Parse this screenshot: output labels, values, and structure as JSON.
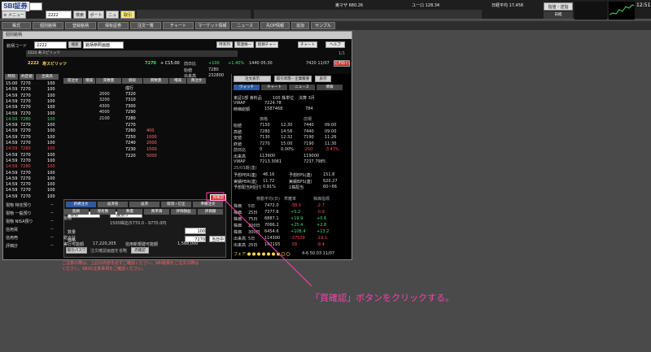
{
  "header": {
    "logo": "SBI証券",
    "code": "2222",
    "search_btn": "検索",
    "menu1": "ポートフォ",
    "menu2": "ニュース",
    "sell_btn": "取引",
    "clock": "12:51",
    "user_btn": "指値・逆指",
    "corner": "1%",
    "mini_labels": [
      "日経",
      "JASDAQ平",
      "NYダウ"
    ]
  },
  "indices": [
    "東マザ 680.26",
    "ユーロ 128.34",
    "日経平均 17,458"
  ],
  "menubar": {
    "items": [
      "株式",
      "個別銘柄",
      "登録銘柄",
      "保有証券",
      "注文一覧",
      "チャート",
      "マーケット情報",
      "ニュース",
      "先OP情報",
      "追加",
      "サンプル"
    ]
  },
  "window": {
    "title": "個別銘柄",
    "code_label": "銘柄コード",
    "code": "2222",
    "search_btn": "検索",
    "combo": "銘柄参照画面",
    "tag_buttons": [
      "時系列",
      "関連株一覧",
      "銘柄チャート",
      "チャート",
      "ヘルプ"
    ],
    "subcode": "2222 寿スピリッツ",
    "page": "1/1"
  },
  "stock": {
    "code": "2222",
    "name": "寿スピリッツ",
    "price": "7270",
    "change": "+ C15:00",
    "prev": "前日比",
    "diff": "+100",
    "pct": "+1.40%",
    "high": "1440 05:30",
    "time": "7420 11/07",
    "open_label": "始値",
    "open": "7280",
    "volume": "出来高",
    "vol_val": "232800",
    "buy_limit": "信用取引"
  },
  "ticks": {
    "headers": [
      "時刻",
      "約定値",
      "出来高"
    ],
    "rows": [
      [
        "15:00",
        "7270",
        "100"
      ],
      [
        "14:59",
        "7270",
        "100"
      ],
      [
        "14:59",
        "7270",
        "100"
      ],
      [
        "14:59",
        "7270",
        "100"
      ],
      [
        "14:59",
        "7270",
        "100"
      ],
      [
        "14:59",
        "7270",
        "100"
      ],
      [
        "14:59",
        "7280",
        "100"
      ],
      [
        "14:59",
        "7270",
        "100"
      ],
      [
        "14:59",
        "7270",
        "100"
      ],
      [
        "14:59",
        "7270",
        "100"
      ],
      [
        "14:59",
        "7270",
        "100"
      ],
      [
        "14:59",
        "7280",
        "100"
      ],
      [
        "14:59",
        "7270",
        "100"
      ],
      [
        "14:59",
        "7270",
        "100"
      ],
      [
        "14:59",
        "7280",
        "100"
      ],
      [
        "14:59",
        "7270",
        "100"
      ],
      [
        "14:59",
        "7270",
        "100"
      ],
      [
        "14:59",
        "7270",
        "100"
      ],
      [
        "14:59",
        "7270",
        "100"
      ],
      [
        "14:59",
        "7270",
        "100"
      ]
    ],
    "red_rows": [
      11,
      14
    ],
    "grn_rows": [
      6
    ]
  },
  "board": {
    "headers": [
      "売注文",
      "増減",
      "売数量",
      "値段",
      "買数量",
      "増減",
      "買注文"
    ],
    "rows": [
      [
        "",
        "",
        "",
        "成行",
        "",
        "",
        ""
      ],
      [
        "",
        "",
        "2000",
        "7320",
        "",
        "",
        ""
      ],
      [
        "",
        "",
        "3200",
        "7310",
        "",
        "",
        ""
      ],
      [
        "",
        "",
        "4300",
        "7300",
        "",
        "",
        ""
      ],
      [
        "",
        "",
        "4000",
        "7290",
        "",
        "",
        ""
      ],
      [
        "",
        "",
        "2100",
        "7280",
        "",
        "",
        ""
      ],
      [
        "",
        "",
        "",
        "7270",
        "",
        "",
        ""
      ],
      [
        "",
        "",
        "",
        "7260",
        "400",
        "",
        ""
      ],
      [
        "",
        "",
        "",
        "7250",
        "1000",
        "",
        ""
      ],
      [
        "",
        "",
        "",
        "7240",
        "2000",
        "",
        ""
      ],
      [
        "",
        "",
        "",
        "7230",
        "1500",
        "",
        ""
      ],
      [
        "",
        "",
        "",
        "7220",
        "5000",
        "",
        ""
      ]
    ]
  },
  "order": {
    "tabs": [
      "新規注文",
      "返済売",
      "返済",
      "取消・訂正",
      "準備注文"
    ],
    "kind": "現物",
    "sel": "一般預り",
    "price_limit": "1500株迄/5770.0 - 9770.0円",
    "qty_label": "数量",
    "qty": "100",
    "price_label": "価格",
    "price": "7270",
    "cond": "当日中",
    "pw": "取引パスワード",
    "preview_btn": "買確認",
    "confirm_btn": "注文確認画面を省略",
    "sell_btn": "売確認"
  },
  "holdings": {
    "rows": [
      [
        "現物 特定預り",
        "--"
      ],
      [
        "現物 一般預り",
        "--"
      ],
      [
        "現物 NISA預り",
        "--"
      ],
      [
        "信用買",
        "--"
      ],
      [
        "信用売",
        "--"
      ],
      [
        "評価計",
        "--"
      ]
    ]
  },
  "positions": {
    "headers": [
      "銘柄",
      "保有数",
      "数量",
      "買単価",
      "評価損益",
      "評価額"
    ],
    "total": "総合計",
    "row": "現物",
    "cash": "実行可能額",
    "cash_val": "17,220,205",
    "margin": "信用新規建可能額",
    "margin_val": "1,568,000"
  },
  "right": {
    "tabs": [
      "注文表示",
      "取引状態・企業概要",
      "表示"
    ],
    "subtabs": [
      "ウォッチ",
      "チャート",
      "ニュース",
      "情報"
    ],
    "company": "東証1部 食料品",
    "rate": "100 株単位",
    "trade": "50 月",
    "settle": "決算 3月",
    "vwap_label": "VWAP",
    "vwap": "7224.78",
    "market_cap": "時価総額",
    "mc": "1587468",
    "turnover": "売買代金",
    "tv": "784"
  },
  "prices": {
    "headers": [
      "",
      "価格",
      "",
      "前場",
      ""
    ],
    "rows": [
      [
        "始値",
        "7150",
        "12:30",
        "7440",
        "09:00"
      ],
      [
        "高値",
        "7280",
        "14:56",
        "7440",
        "09:00"
      ],
      [
        "安値",
        "7130",
        "12:32",
        "7190",
        "11:26"
      ],
      [
        "終値",
        "7270",
        "15:00",
        "7190",
        "11:30"
      ],
      [
        "前日比",
        "0",
        "0.00%",
        "-250",
        "-3.47%"
      ],
      [
        "出来高",
        "113900",
        "",
        "119000",
        ""
      ],
      [
        "VWAP",
        "7213.3061",
        "",
        "7237.7985",
        ""
      ]
    ]
  },
  "fund": {
    "period": "25/03期(連)",
    "rows": [
      [
        "予想PER(連)",
        "46.16",
        "予想EPS(連)",
        "151.8"
      ],
      [
        "実績PBR(連)",
        "11.72",
        "実績BPS(連)",
        "620.27"
      ],
      [
        "予想配当利回り",
        "0.91%",
        "1株配当",
        "60~66"
      ]
    ]
  },
  "tech": {
    "headers": [
      "",
      "移動平均(日)",
      "乖離率",
      "株価指標"
    ],
    "rows": [
      [
        "株価",
        "5日",
        "7472.0",
        "-38.0",
        "-2.7"
      ],
      [
        "株価",
        "25日",
        "7377.6",
        "+5.2",
        "-0.9"
      ],
      [
        "株価",
        "75日",
        "6887.1",
        "+19.9",
        "+0.6"
      ],
      [
        "株価",
        "200日",
        "7066.2",
        "+25.4",
        "+2.8"
      ],
      [
        "株価",
        "300日",
        "6454.6",
        "+108.4",
        "+13.2"
      ],
      [
        "出来高",
        "5日",
        "114300",
        "-27539",
        "-19.1"
      ],
      [
        "出来高",
        "25日",
        "142193",
        "-58",
        "-9.4"
      ]
    ],
    "footer": "フェア",
    "footer_val": "4-6 50.03 11/07"
  },
  "note": "ご注意の際は、上記の内容を必ずご確認ください。SBI銘柄をご注文の際は",
  "note2": "ください。SBIの注意事項をご確認ください。",
  "callout": "「買確認」ボタンをクリックする。"
}
